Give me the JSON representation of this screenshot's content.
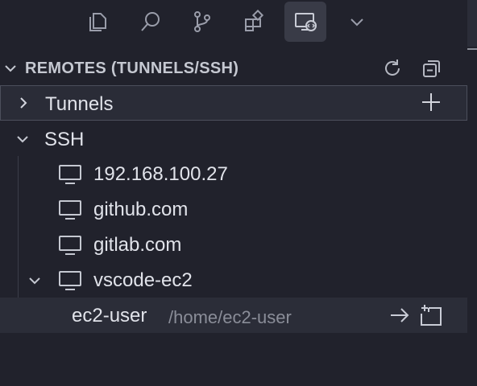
{
  "activity_bar": {
    "items": [
      {
        "name": "explorer-icon"
      },
      {
        "name": "search-icon"
      },
      {
        "name": "source-control-icon"
      },
      {
        "name": "extensions-icon"
      },
      {
        "name": "remote-explorer-icon",
        "active": true
      },
      {
        "name": "chevron-down-icon"
      }
    ]
  },
  "section": {
    "title": "REMOTES (TUNNELS/SSH)",
    "actions": [
      "refresh-icon",
      "collapse-all-icon"
    ]
  },
  "tree": {
    "tunnels": {
      "label": "Tunnels",
      "expanded": false,
      "action": "add-icon"
    },
    "ssh": {
      "label": "SSH",
      "expanded": true,
      "hosts": [
        {
          "label": "192.168.100.27"
        },
        {
          "label": "github.com"
        },
        {
          "label": "gitlab.com"
        },
        {
          "label": "vscode-ec2",
          "expanded": true
        }
      ],
      "folder": {
        "label": "ec2-user",
        "path": "/home/ec2-user",
        "actions": [
          "connect-arrow-icon",
          "open-in-new-window-icon"
        ]
      }
    }
  },
  "colors": {
    "background": "#21222c",
    "active_icon_bg": "#393b47",
    "text": "#e1e3ea",
    "muted": "#8a8d98"
  }
}
